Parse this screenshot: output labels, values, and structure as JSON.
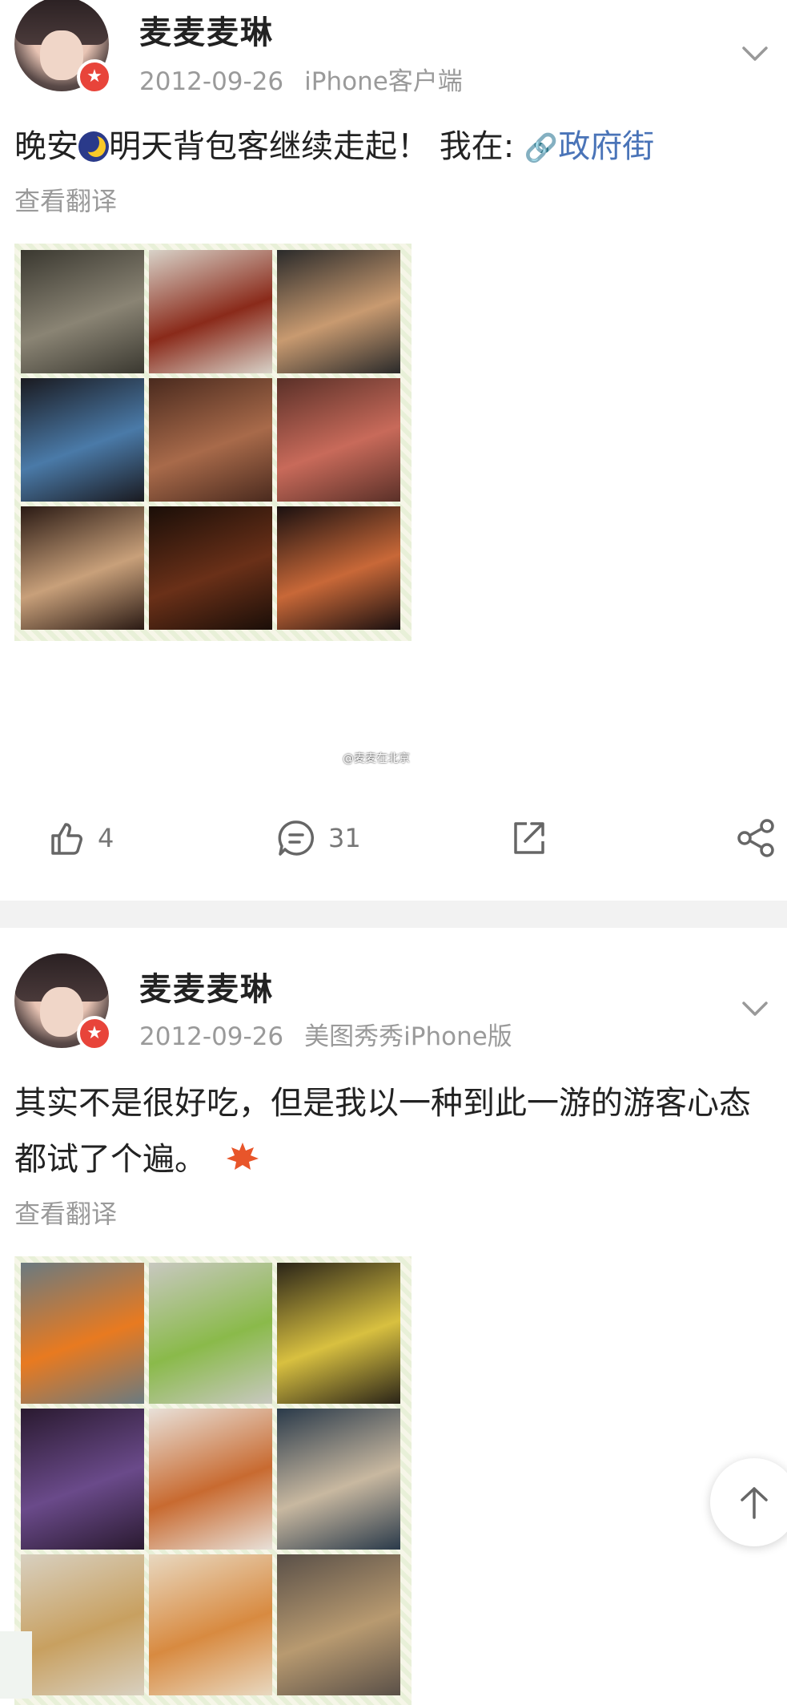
{
  "posts": [
    {
      "username": "麦麦麦琳",
      "date": "2012-09-26",
      "source": "iPhone客户端",
      "text_before_emoji": "晚安",
      "text_after_emoji": "明天背包客继续走起！ 我在:",
      "location": "政府街",
      "translate_label": "查看翻译",
      "watermark": "@麦麦在北京",
      "likes": "4",
      "comments": "31",
      "images": [
        {
          "name": "courtyard",
          "c1": "#3a3830",
          "c2": "#8a8474"
        },
        {
          "name": "sign-stone",
          "c1": "#d8d2c8",
          "c2": "#8a2a1a"
        },
        {
          "name": "lantern",
          "c1": "#2a2a2a",
          "c2": "#c89a70"
        },
        {
          "name": "opera-headdress",
          "c1": "#1a1a20",
          "c2": "#4a7aa8"
        },
        {
          "name": "cafe-interior",
          "c1": "#4a2a1e",
          "c2": "#a86a4a"
        },
        {
          "name": "bookshelf-room",
          "c1": "#5a3028",
          "c2": "#c86a5a"
        },
        {
          "name": "coffee-cup",
          "c1": "#2a1a14",
          "c2": "#c8a07a"
        },
        {
          "name": "dark-room",
          "c1": "#1a0e08",
          "c2": "#6a3018"
        },
        {
          "name": "lamps-shop",
          "c1": "#1a1010",
          "c2": "#c86838"
        }
      ]
    },
    {
      "username": "麦麦麦琳",
      "date": "2012-09-26",
      "source": "美图秀秀iPhone版",
      "text_line1": "其实不是很好吃，但是我以一种到此一游的游客心态",
      "text_line2": "都试了个遍。",
      "translate_label": "查看翻译",
      "images": [
        {
          "name": "chili-sauce-bottle",
          "c1": "#6a7a80",
          "c2": "#e87a20"
        },
        {
          "name": "green-drink-bottle",
          "c1": "#c8c8c0",
          "c2": "#8aba4a"
        },
        {
          "name": "snack-shelves",
          "c1": "#2a2418",
          "c2": "#d8c040"
        },
        {
          "name": "chestnuts",
          "c1": "#2a1a30",
          "c2": "#6a4a8a"
        },
        {
          "name": "stir-fry-plates",
          "c1": "#e8e0d8",
          "c2": "#c86a30"
        },
        {
          "name": "grilled-fish",
          "c1": "#2a3a4a",
          "c2": "#c8b8a0"
        },
        {
          "name": "flatbreads",
          "c1": "#d8d0c0",
          "c2": "#c8a060"
        },
        {
          "name": "noodle-dish",
          "c1": "#e8d8c0",
          "c2": "#d88a40"
        },
        {
          "name": "bowls",
          "c1": "#5a5048",
          "c2": "#b89a70"
        }
      ]
    }
  ],
  "colors": {
    "link": "#4a74b8",
    "meta": "#9a9a9a",
    "badge": "#e8443a"
  }
}
